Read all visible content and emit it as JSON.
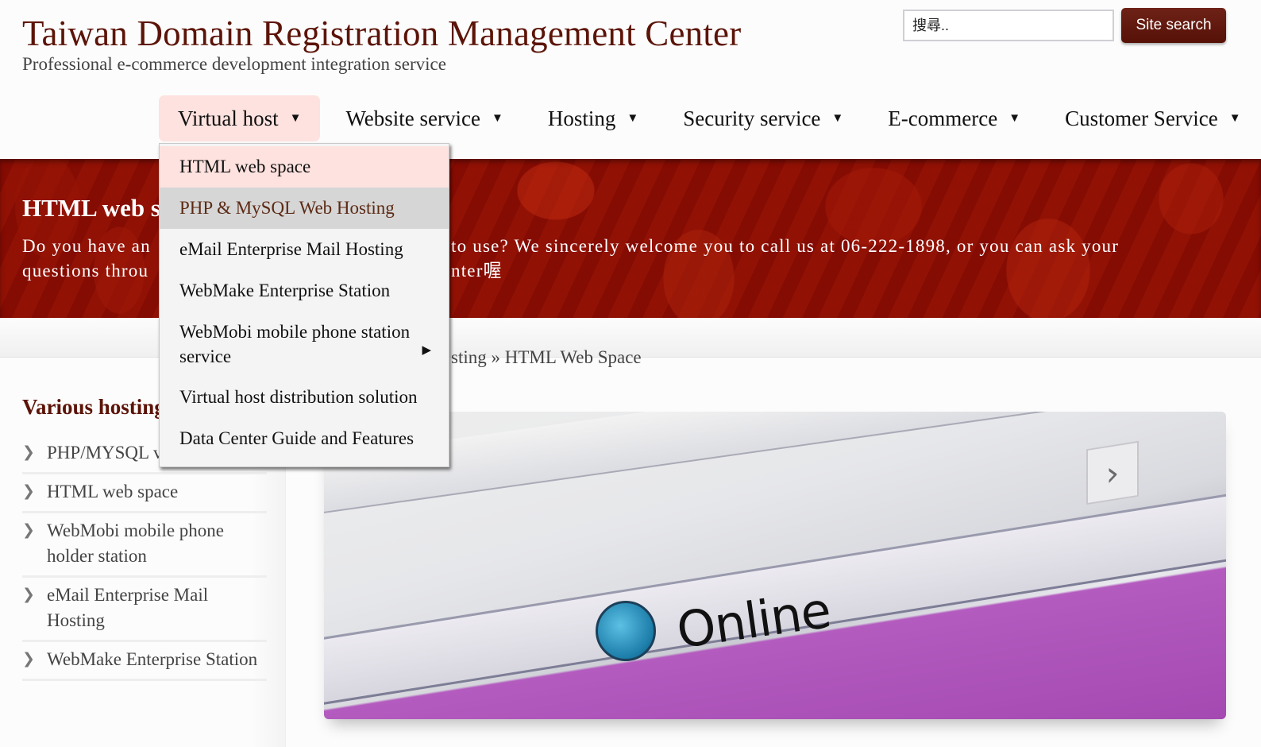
{
  "header": {
    "site_title": "Taiwan Domain Registration Management Center",
    "tagline": "Professional e-commerce development integration service",
    "search": {
      "placeholder": "搜尋..",
      "value": "",
      "button_label": "Site search"
    }
  },
  "nav": {
    "items": [
      {
        "label": "Virtual host",
        "active": true
      },
      {
        "label": "Website service",
        "active": false
      },
      {
        "label": "Hosting",
        "active": false
      },
      {
        "label": "Security service",
        "active": false
      },
      {
        "label": "E-commerce",
        "active": false
      },
      {
        "label": "Customer Service",
        "active": false
      }
    ],
    "caret_icon": "▼"
  },
  "dropdown": {
    "parent": "Virtual host",
    "items": [
      {
        "label": "HTML web space",
        "state": "current"
      },
      {
        "label": "PHP & MySQL Web Hosting",
        "state": "hover"
      },
      {
        "label": "eMail Enterprise Mail Hosting",
        "state": "normal"
      },
      {
        "label": "WebMake Enterprise Station",
        "state": "normal"
      },
      {
        "label": "WebMobi mobile phone station service",
        "state": "normal",
        "has_submenu": true
      },
      {
        "label": "Virtual host distribution solution",
        "state": "normal"
      },
      {
        "label": "Data Center Guide and Features",
        "state": "normal"
      }
    ],
    "submenu_icon": "▶"
  },
  "banner": {
    "title_visible": "HTML web s",
    "text_left_line1": "Do you have an",
    "text_left_line2": "questions throu",
    "text_right_line1": "to use? We sincerely welcome you to call us at 06-222-1898, or you can ask your",
    "text_right_line2": "nter喔"
  },
  "breadcrumb": {
    "visible_text": "sting » HTML Web Space"
  },
  "sidebar": {
    "title_visible": "Various hosting",
    "items": [
      {
        "label": "PHP/MYSQL v hosting"
      },
      {
        "label": "HTML web space"
      },
      {
        "label": "WebMobi mobile phone holder station"
      },
      {
        "label": "eMail Enterprise Mail Hosting"
      },
      {
        "label": "WebMake Enterprise Station"
      }
    ],
    "chevron_icon": "❯"
  },
  "hero": {
    "image_text": "Online",
    "arrow_icon": "›"
  },
  "colors": {
    "brand": "#5c1408",
    "button": "#6e2217",
    "banner": "#8c0f04",
    "nav_active_bg": "#fde2df",
    "menu_hover_bg": "#d6d6d6"
  }
}
